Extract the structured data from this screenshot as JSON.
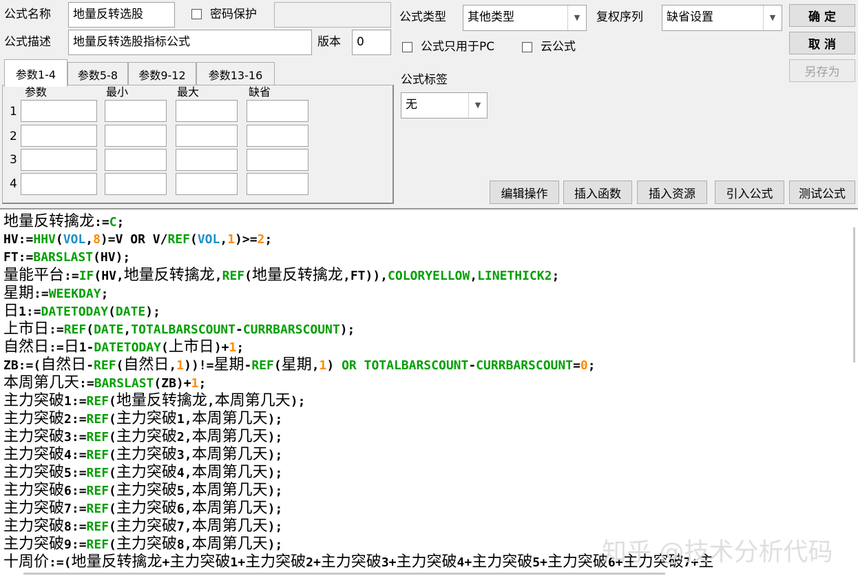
{
  "header": {
    "name_label": "公式名称",
    "name_value": "地量反转选股",
    "password_label": "密码保护",
    "password_value": "",
    "desc_label": "公式描述",
    "desc_value": "地量反转选股指标公式",
    "version_label": "版本",
    "version_value": "0"
  },
  "formula_type": {
    "label": "公式类型",
    "value": "其他类型"
  },
  "adjust_seq": {
    "label": "复权序列",
    "value": "缺省设置"
  },
  "options": {
    "pc_only_label": "公式只用于PC",
    "cloud_label": "云公式"
  },
  "tag": {
    "label": "公式标签",
    "value": "无"
  },
  "buttons": {
    "ok": "确  定",
    "cancel": "取  消",
    "save_as": "另存为",
    "edit_ops": "编辑操作",
    "insert_func": "插入函数",
    "insert_res": "插入资源",
    "import_formula": "引入公式",
    "test_formula": "测试公式"
  },
  "tabs": [
    "参数1-4",
    "参数5-8",
    "参数9-12",
    "参数13-16"
  ],
  "params": {
    "headers": [
      "参数",
      "最小",
      "最大",
      "缺省"
    ],
    "rows": [
      "1",
      "2",
      "3",
      "4"
    ]
  },
  "code": [
    [
      [
        "cn",
        "地量反转擒龙"
      ],
      [
        "op",
        ":="
      ],
      [
        "kw",
        "C"
      ],
      [
        "op",
        ";"
      ]
    ],
    [
      [
        "op",
        "HV:="
      ],
      [
        "fn",
        "HHV"
      ],
      [
        "op",
        "("
      ],
      [
        "vr",
        "VOL"
      ],
      [
        "op",
        ","
      ],
      [
        "nm",
        "8"
      ],
      [
        "op",
        ")=V OR V/"
      ],
      [
        "fn",
        "REF"
      ],
      [
        "op",
        "("
      ],
      [
        "vr",
        "VOL"
      ],
      [
        "op",
        ","
      ],
      [
        "nm",
        "1"
      ],
      [
        "op",
        ")>="
      ],
      [
        "nm",
        "2"
      ],
      [
        "op",
        ";"
      ]
    ],
    [
      [
        "op",
        "FT:="
      ],
      [
        "fn",
        "BARSLAST"
      ],
      [
        "op",
        "(HV);"
      ]
    ],
    [
      [
        "cn",
        "量能平台"
      ],
      [
        "op",
        ":="
      ],
      [
        "fn",
        "IF"
      ],
      [
        "op",
        "(HV,"
      ],
      [
        "cn",
        "地量反转擒龙"
      ],
      [
        "op",
        ","
      ],
      [
        "fn",
        "REF"
      ],
      [
        "op",
        "("
      ],
      [
        "cn",
        "地量反转擒龙"
      ],
      [
        "op",
        ",FT)),"
      ],
      [
        "kw",
        "COLORYELLOW"
      ],
      [
        "op",
        ","
      ],
      [
        "kw",
        "LINETHICK2"
      ],
      [
        "op",
        ";"
      ]
    ],
    [
      [
        "cn",
        "星期"
      ],
      [
        "op",
        ":="
      ],
      [
        "fn",
        "WEEKDAY"
      ],
      [
        "op",
        ";"
      ]
    ],
    [
      [
        "cn",
        "日"
      ],
      [
        "op",
        "1:="
      ],
      [
        "fn",
        "DATETODAY"
      ],
      [
        "op",
        "("
      ],
      [
        "fn",
        "DATE"
      ],
      [
        "op",
        ");"
      ]
    ],
    [
      [
        "cn",
        "上市日"
      ],
      [
        "op",
        ":="
      ],
      [
        "fn",
        "REF"
      ],
      [
        "op",
        "("
      ],
      [
        "fn",
        "DATE"
      ],
      [
        "op",
        ","
      ],
      [
        "fn",
        "TOTALBARSCOUNT"
      ],
      [
        "op",
        "-"
      ],
      [
        "fn",
        "CURRBARSCOUNT"
      ],
      [
        "op",
        ");"
      ]
    ],
    [
      [
        "cn",
        "自然日"
      ],
      [
        "op",
        ":="
      ],
      [
        "cn",
        "日"
      ],
      [
        "op",
        "1-"
      ],
      [
        "fn",
        "DATETODAY"
      ],
      [
        "op",
        "("
      ],
      [
        "cn",
        "上市日"
      ],
      [
        "op",
        ")+"
      ],
      [
        "nm",
        "1"
      ],
      [
        "op",
        ";"
      ]
    ],
    [
      [
        "op",
        "ZB:=("
      ],
      [
        "cn",
        "自然日"
      ],
      [
        "op",
        "-"
      ],
      [
        "fn",
        "REF"
      ],
      [
        "op",
        "("
      ],
      [
        "cn",
        "自然日"
      ],
      [
        "op",
        ","
      ],
      [
        "nm",
        "1"
      ],
      [
        "op",
        "))!="
      ],
      [
        "cn",
        "星期"
      ],
      [
        "op",
        "-"
      ],
      [
        "fn",
        "REF"
      ],
      [
        "op",
        "("
      ],
      [
        "cn",
        "星期"
      ],
      [
        "op",
        ","
      ],
      [
        "nm",
        "1"
      ],
      [
        "op",
        ") "
      ],
      [
        "kw",
        "OR"
      ],
      [
        "op",
        " "
      ],
      [
        "fn",
        "TOTALBARSCOUNT"
      ],
      [
        "op",
        "-"
      ],
      [
        "fn",
        "CURRBARSCOUNT"
      ],
      [
        "op",
        "="
      ],
      [
        "nm",
        "0"
      ],
      [
        "op",
        ";"
      ]
    ],
    [
      [
        "cn",
        "本周第几天"
      ],
      [
        "op",
        ":="
      ],
      [
        "fn",
        "BARSLAST"
      ],
      [
        "op",
        "(ZB)+"
      ],
      [
        "nm",
        "1"
      ],
      [
        "op",
        ";"
      ]
    ],
    [
      [
        "cn",
        "主力突破"
      ],
      [
        "op",
        "1:="
      ],
      [
        "fn",
        "REF"
      ],
      [
        "op",
        "("
      ],
      [
        "cn",
        "地量反转擒龙"
      ],
      [
        "op",
        ","
      ],
      [
        "cn",
        "本周第几天"
      ],
      [
        "op",
        ");"
      ]
    ],
    [
      [
        "cn",
        "主力突破"
      ],
      [
        "op",
        "2:="
      ],
      [
        "fn",
        "REF"
      ],
      [
        "op",
        "("
      ],
      [
        "cn",
        "主力突破"
      ],
      [
        "op",
        "1,"
      ],
      [
        "cn",
        "本周第几天"
      ],
      [
        "op",
        ");"
      ]
    ],
    [
      [
        "cn",
        "主力突破"
      ],
      [
        "op",
        "3:="
      ],
      [
        "fn",
        "REF"
      ],
      [
        "op",
        "("
      ],
      [
        "cn",
        "主力突破"
      ],
      [
        "op",
        "2,"
      ],
      [
        "cn",
        "本周第几天"
      ],
      [
        "op",
        ");"
      ]
    ],
    [
      [
        "cn",
        "主力突破"
      ],
      [
        "op",
        "4:="
      ],
      [
        "fn",
        "REF"
      ],
      [
        "op",
        "("
      ],
      [
        "cn",
        "主力突破"
      ],
      [
        "op",
        "3,"
      ],
      [
        "cn",
        "本周第几天"
      ],
      [
        "op",
        ");"
      ]
    ],
    [
      [
        "cn",
        "主力突破"
      ],
      [
        "op",
        "5:="
      ],
      [
        "fn",
        "REF"
      ],
      [
        "op",
        "("
      ],
      [
        "cn",
        "主力突破"
      ],
      [
        "op",
        "4,"
      ],
      [
        "cn",
        "本周第几天"
      ],
      [
        "op",
        ");"
      ]
    ],
    [
      [
        "cn",
        "主力突破"
      ],
      [
        "op",
        "6:="
      ],
      [
        "fn",
        "REF"
      ],
      [
        "op",
        "("
      ],
      [
        "cn",
        "主力突破"
      ],
      [
        "op",
        "5,"
      ],
      [
        "cn",
        "本周第几天"
      ],
      [
        "op",
        ");"
      ]
    ],
    [
      [
        "cn",
        "主力突破"
      ],
      [
        "op",
        "7:="
      ],
      [
        "fn",
        "REF"
      ],
      [
        "op",
        "("
      ],
      [
        "cn",
        "主力突破"
      ],
      [
        "op",
        "6,"
      ],
      [
        "cn",
        "本周第几天"
      ],
      [
        "op",
        ");"
      ]
    ],
    [
      [
        "cn",
        "主力突破"
      ],
      [
        "op",
        "8:="
      ],
      [
        "fn",
        "REF"
      ],
      [
        "op",
        "("
      ],
      [
        "cn",
        "主力突破"
      ],
      [
        "op",
        "7,"
      ],
      [
        "cn",
        "本周第几天"
      ],
      [
        "op",
        ");"
      ]
    ],
    [
      [
        "cn",
        "主力突破"
      ],
      [
        "op",
        "9:="
      ],
      [
        "fn",
        "REF"
      ],
      [
        "op",
        "("
      ],
      [
        "cn",
        "主力突破"
      ],
      [
        "op",
        "8,"
      ],
      [
        "cn",
        "本周第几天"
      ],
      [
        "op",
        ");"
      ]
    ],
    [
      [
        "cn",
        "十周价"
      ],
      [
        "op",
        ":=("
      ],
      [
        "cn",
        "地量反转擒龙"
      ],
      [
        "op",
        "+"
      ],
      [
        "cn",
        "主力突破"
      ],
      [
        "op",
        "1+"
      ],
      [
        "cn",
        "主力突破"
      ],
      [
        "op",
        "2+"
      ],
      [
        "cn",
        "主力突破"
      ],
      [
        "op",
        "3+"
      ],
      [
        "cn",
        "主力突破"
      ],
      [
        "op",
        "4+"
      ],
      [
        "cn",
        "主力突破"
      ],
      [
        "op",
        "5+"
      ],
      [
        "cn",
        "主力突破"
      ],
      [
        "op",
        "6+"
      ],
      [
        "cn",
        "主力突破"
      ],
      [
        "op",
        "7+"
      ],
      [
        "cn",
        "主"
      ]
    ]
  ],
  "watermark": "知乎 @技术分析代码"
}
